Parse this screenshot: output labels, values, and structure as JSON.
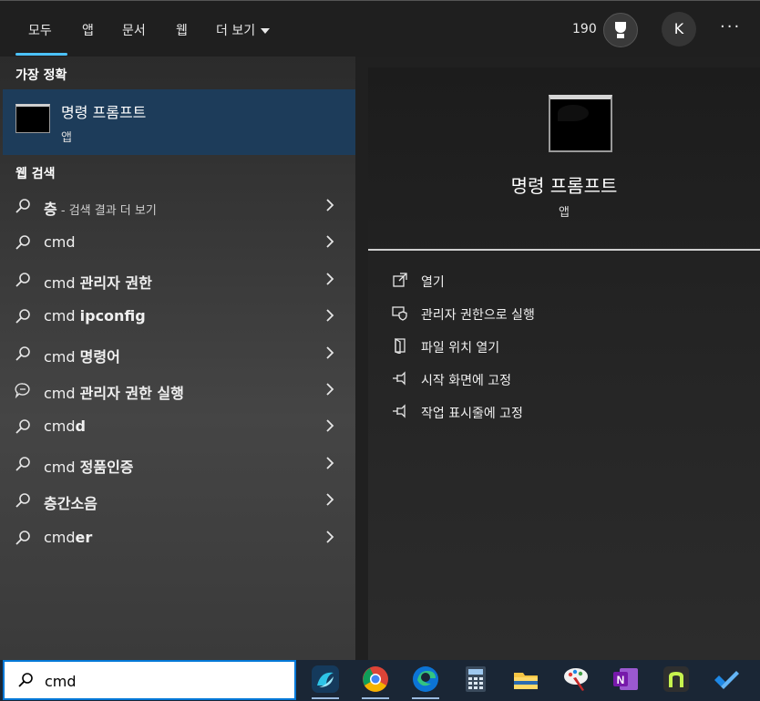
{
  "nav": {
    "tabs": [
      "모두",
      "앱",
      "문서",
      "웹",
      "더 보기"
    ],
    "points": "190",
    "avatar_initial": "K",
    "more_menu": "···"
  },
  "left": {
    "best_match_header": "가장 정확",
    "best_match": {
      "title": "명령 프롬프트",
      "subtitle": "앱",
      "icon": "command-prompt-icon"
    },
    "web_header": "웹 검색",
    "results": [
      {
        "prefix": "",
        "bold": "층",
        "suffix": " - 검색 결과 더 보기",
        "icon": "search-icon"
      },
      {
        "prefix": "cmd",
        "bold": "",
        "suffix": "",
        "icon": "search-icon"
      },
      {
        "prefix": "cmd ",
        "bold": "관리자 권한",
        "suffix": "",
        "icon": "search-icon"
      },
      {
        "prefix": "cmd ",
        "bold": "ipconfig",
        "suffix": "",
        "icon": "search-icon"
      },
      {
        "prefix": "cmd ",
        "bold": "명령어",
        "suffix": "",
        "icon": "search-icon"
      },
      {
        "prefix": "cmd ",
        "bold": "관리자 권한 실행",
        "suffix": "",
        "icon": "chat-icon"
      },
      {
        "prefix": "cmd",
        "bold": "d",
        "suffix": "",
        "icon": "search-icon"
      },
      {
        "prefix": "cmd ",
        "bold": "정품인증",
        "suffix": "",
        "icon": "search-icon"
      },
      {
        "prefix": "",
        "bold": "층간소음",
        "suffix": "",
        "icon": "search-icon"
      },
      {
        "prefix": "cmd",
        "bold": "er",
        "suffix": "",
        "icon": "search-icon"
      }
    ]
  },
  "right": {
    "title": "명령 프롬프트",
    "subtitle": "앱",
    "actions": [
      {
        "label": "열기",
        "icon": "open-icon"
      },
      {
        "label": "관리자 권한으로 실행",
        "icon": "shield-icon"
      },
      {
        "label": "파일 위치 열기",
        "icon": "folder-icon"
      },
      {
        "label": "시작 화면에 고정",
        "icon": "pin-icon"
      },
      {
        "label": "작업 표시줄에 고정",
        "icon": "pin-icon"
      }
    ]
  },
  "taskbar": {
    "search_value": "cmd",
    "apps": [
      "app-icon",
      "chrome-icon",
      "edge-icon",
      "calculator-icon",
      "file-explorer-icon",
      "paint-icon",
      "onenote-icon",
      "notion-like-icon",
      "todo-icon"
    ]
  },
  "colors": {
    "accent": "#4cc2ff",
    "best_match_bg": "#1d3c5a",
    "taskbar_bg": "#1a2635",
    "search_border": "#0078d7"
  }
}
